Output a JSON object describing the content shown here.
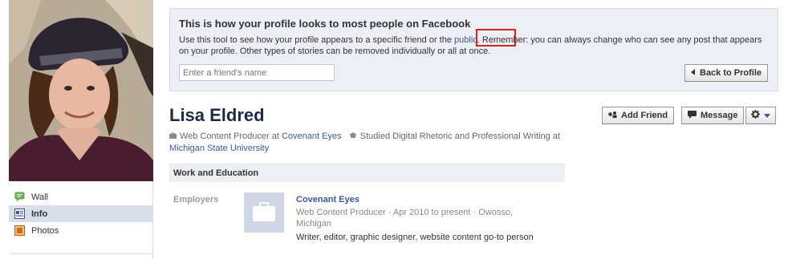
{
  "preview": {
    "title": "This is how your profile looks to most people on Facebook",
    "desc_before": "Use this tool to see how your profile appears to a specific friend or the ",
    "public_link": "public",
    "desc_after": ". Remember: you can always change who can see any post that appears on your profile. Other types of stories can be removed individually or all at once.",
    "friend_placeholder": "Enter a friend's name",
    "back_label": "Back to Profile"
  },
  "profile": {
    "name": "Lisa Eldred",
    "job_title": "Web Content Producer at ",
    "employer_link": "Covenant Eyes",
    "education_prefix": "Studied Digital Rhetoric and Professional Writing at ",
    "school_link": "Michigan State University"
  },
  "actions": {
    "add_friend": "Add Friend",
    "message": "Message"
  },
  "nav": {
    "items": [
      {
        "label": "Wall",
        "icon": "wall-icon",
        "color": "#6aa84f"
      },
      {
        "label": "Info",
        "icon": "info-icon",
        "color": "#3b5998"
      },
      {
        "label": "Photos",
        "icon": "photos-icon",
        "color": "#d2691e"
      }
    ]
  },
  "work": {
    "section_title": "Work and Education",
    "employers_label": "Employers",
    "employer_name": "Covenant Eyes",
    "employer_meta": "Web Content Producer · Apr 2010 to present · Owosso, Michigan",
    "employer_desc": "Writer, editor, graphic designer, website content go-to person"
  },
  "colors": {
    "link": "#3b5998",
    "banner_bg": "#eceff5",
    "highlight": "#e0201a"
  }
}
